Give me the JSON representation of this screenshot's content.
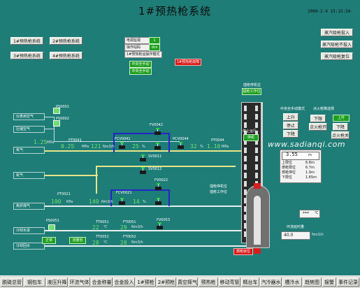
{
  "header": {
    "title": "1#预热枪系统",
    "datetime": "2009-2-9  15:15:34"
  },
  "systems": [
    "1#预热枪系统",
    "2#预热枪系统",
    "3#预热枪系统",
    "4#预热枪系统"
  ],
  "top_controls": {
    "mode_label": "电源监视",
    "mode_value": "1",
    "op_label": "操作站码",
    "op_value": "dcs",
    "auto_mode": "1#预热枪运操作模式",
    "central_btn": "中央全手动",
    "local_btn": "中央全手动",
    "alarm_btn": "1#预热枪故障"
  },
  "right_buttons": [
    "蒸汽吸枪投入",
    "蒸汽吸枪不投入",
    "蒸汽吸枪复位"
  ],
  "gas_labels": {
    "instrument_air": "仪表用空气",
    "compressed_air": "压缩空气",
    "oxygen": "氧气",
    "nitrogen": "氮气",
    "coke_gas": "焦炉煤气",
    "cooling_supply": "冷却水进",
    "cooling_return": "冷却回水"
  },
  "tags": {
    "ps0001": "PS0001",
    "ps0002": "PS0002",
    "pt0041": "PT0041",
    "fcv0041": "FCV0041",
    "fv0042": "FV0042",
    "pcv0044": "PCV0044",
    "pt0044": "PT0044",
    "sv0011": "SV0011",
    "sv0012": "SV0012",
    "pt0021": "PT0021",
    "fcv0021": "FCV0021",
    "fv0022": "FV0022",
    "ps0051": "PS0051",
    "tt0051": "TT0051",
    "ft0051": "FT0051",
    "tt0052": "TT0052",
    "ft0052": "FT0052",
    "fv0053": "FV0053"
  },
  "readings": {
    "pt0041_val": "1.25",
    "pt0041_unit": "MPa",
    "pt0041b_val": "0.25",
    "pt0041b_unit": "MPa",
    "fcv0041_val": "121",
    "fcv0041_unit": "Nm3/h",
    "fv0042_val": "25",
    "fv0042_unit": "%",
    "pcv0044_val": "32",
    "pcv0044_unit": "%",
    "pt0044_val": "1.10",
    "pt0044_unit": "MPa",
    "pt0021_val": "100",
    "pt0021_unit": "KPa",
    "fcv0021_val": "149",
    "fcv0021_unit": "Nm3/h",
    "fv0022_val": "14",
    "fv0022_unit": "%",
    "tt0051_val": "22",
    "tt0051_unit": "℃",
    "ft0051_val": "29",
    "ft0051_unit": "Nm3/h",
    "tt0052_val": "28",
    "tt0052_unit": "℃",
    "ft0052_val": "28",
    "ft0052_unit": "Nm3/h"
  },
  "cooling_btns": {
    "normal": "正常",
    "low_flow": "流量低"
  },
  "lance": {
    "upper_label": "插枪停机位",
    "upper_sub": "插枪工作位",
    "stop_label": "停止运行",
    "stop_value": "停机",
    "lower_label": "插枪停机位",
    "lower_sub": "插枪工作位",
    "working_label": "插接开始"
  },
  "local_panel": {
    "title": "中央全手动模式",
    "btns": [
      "上升",
      "停止",
      "下降"
    ]
  },
  "ignition_panel": {
    "title": "点火枪降选择",
    "left_btns": [
      "下限",
      "点火枪开"
    ],
    "right_btns": [
      "上升",
      "下降",
      "点火枪关"
    ]
  },
  "position_panel": {
    "current_value": "3.55",
    "current_unit": "m",
    "rows": [
      {
        "label": "上限位",
        "value": "6.8m"
      },
      {
        "label": "燃枪限位",
        "value": "6.7m"
      },
      {
        "label": "燃枪停位",
        "value": "1.9m"
      },
      {
        "label": "下限位",
        "value": "1.65m"
      }
    ]
  },
  "temp_box": {
    "value": "***",
    "unit": "℃"
  },
  "delay_box": {
    "label": "环流延时量",
    "value": "40.0",
    "unit": "Nm3/h"
  },
  "status_btn": "燃枪就位",
  "watermark": "www.sadianqi.com",
  "nav": [
    "脱硫总管",
    "钢包车",
    "液压升降",
    "环流气体",
    "合金称量",
    "合金投入",
    "1#预枪",
    "2#预枪",
    "真空摔气",
    "预热枪",
    "移动弯管",
    "精台车",
    "汽冷器水",
    "槽冷水",
    "趋势图",
    "报警",
    "事件记录"
  ],
  "colors": {
    "bg": "#1f7d78",
    "value": "#6ee46e",
    "alarm": "#d91a1a",
    "run": "#1ea01e",
    "pipe_o2": "#e8e68a",
    "pipe_n2": "#2424c8"
  }
}
